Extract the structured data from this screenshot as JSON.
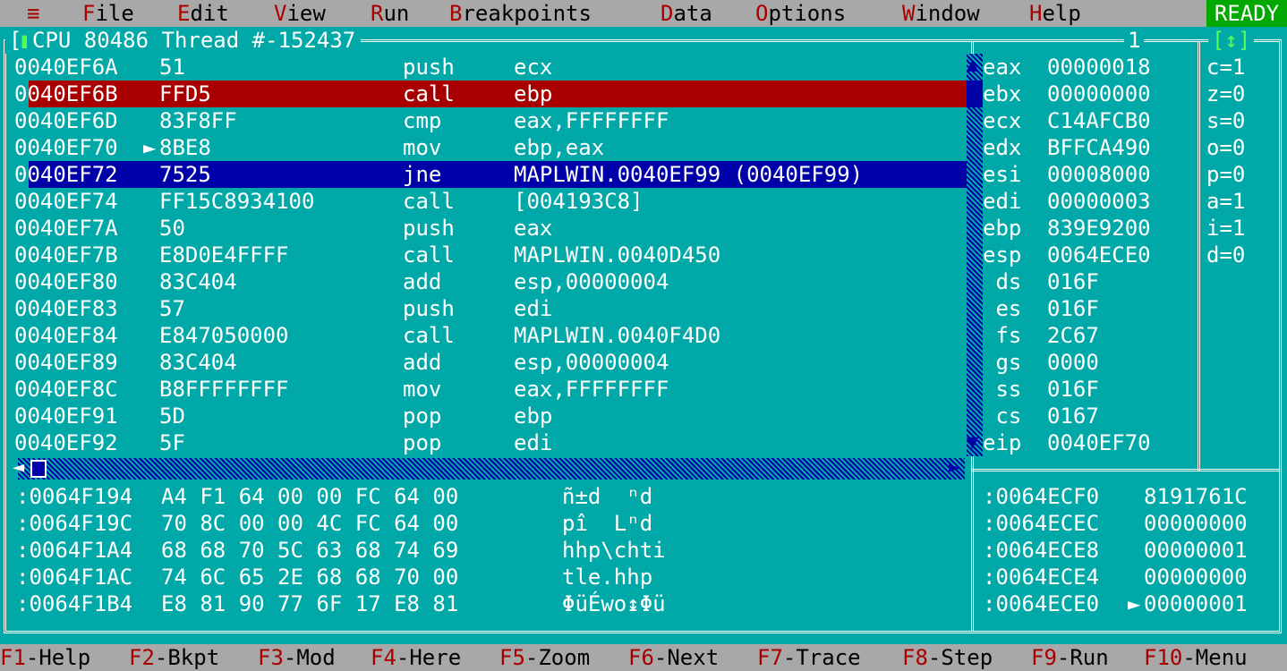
{
  "menubar": {
    "system": "≡",
    "items": [
      {
        "hot": "F",
        "rest": "ile"
      },
      {
        "hot": "E",
        "rest": "dit"
      },
      {
        "hot": "V",
        "rest": "iew"
      },
      {
        "hot": "R",
        "rest": "un"
      },
      {
        "hot": "B",
        "rest": "reakpoints"
      },
      {
        "hot": "D",
        "rest": "ata"
      },
      {
        "hot": "O",
        "rest": "ptions"
      },
      {
        "hot": "W",
        "rest": "indow"
      },
      {
        "hot": "H",
        "rest": "elp"
      }
    ],
    "status": "READY"
  },
  "window": {
    "close_open": "[",
    "close_box": "■",
    "close_close": "]",
    "title": "CPU 80486 Thread #-152437",
    "number": "1",
    "zoom": "[↕]"
  },
  "disasm": {
    "rows": [
      {
        "addr": "0040EF6A",
        "mark": " ",
        "bytes": "51",
        "mnem": "push",
        "ops": "ecx",
        "hl": ""
      },
      {
        "addr": "0040EF6B",
        "mark": " ",
        "bytes": "FFD5",
        "mnem": "call",
        "ops": "ebp",
        "hl": "red"
      },
      {
        "addr": "0040EF6D",
        "mark": " ",
        "bytes": "83F8FF",
        "mnem": "cmp",
        "ops": "eax,FFFFFFFF",
        "hl": ""
      },
      {
        "addr": "0040EF70",
        "mark": "►",
        "bytes": "8BE8",
        "mnem": "mov",
        "ops": "ebp,eax",
        "hl": ""
      },
      {
        "addr": "0040EF72",
        "mark": " ",
        "bytes": "7525",
        "mnem": "jne",
        "ops": "MAPLWIN.0040EF99 (0040EF99)",
        "hl": "blue"
      },
      {
        "addr": "0040EF74",
        "mark": " ",
        "bytes": "FF15C8934100",
        "mnem": "call",
        "ops": "[004193C8]",
        "hl": ""
      },
      {
        "addr": "0040EF7A",
        "mark": " ",
        "bytes": "50",
        "mnem": "push",
        "ops": "eax",
        "hl": ""
      },
      {
        "addr": "0040EF7B",
        "mark": " ",
        "bytes": "E8D0E4FFFF",
        "mnem": "call",
        "ops": "MAPLWIN.0040D450",
        "hl": ""
      },
      {
        "addr": "0040EF80",
        "mark": " ",
        "bytes": "83C404",
        "mnem": "add",
        "ops": "esp,00000004",
        "hl": ""
      },
      {
        "addr": "0040EF83",
        "mark": " ",
        "bytes": "57",
        "mnem": "push",
        "ops": "edi",
        "hl": ""
      },
      {
        "addr": "0040EF84",
        "mark": " ",
        "bytes": "E847050000",
        "mnem": "call",
        "ops": "MAPLWIN.0040F4D0",
        "hl": ""
      },
      {
        "addr": "0040EF89",
        "mark": " ",
        "bytes": "83C404",
        "mnem": "add",
        "ops": "esp,00000004",
        "hl": ""
      },
      {
        "addr": "0040EF8C",
        "mark": " ",
        "bytes": "B8FFFFFFFF",
        "mnem": "mov",
        "ops": "eax,FFFFFFFF",
        "hl": ""
      },
      {
        "addr": "0040EF91",
        "mark": " ",
        "bytes": "5D",
        "mnem": "pop",
        "ops": "ebp",
        "hl": ""
      },
      {
        "addr": "0040EF92",
        "mark": " ",
        "bytes": "5F",
        "mnem": "pop",
        "ops": "edi",
        "hl": ""
      }
    ]
  },
  "registers": [
    {
      "name": "eax",
      "value": "00000018"
    },
    {
      "name": "ebx",
      "value": "00000000"
    },
    {
      "name": "ecx",
      "value": "C14AFCB0"
    },
    {
      "name": "edx",
      "value": "BFFCA490"
    },
    {
      "name": "esi",
      "value": "00008000"
    },
    {
      "name": "edi",
      "value": "00000003"
    },
    {
      "name": "ebp",
      "value": "839E9200"
    },
    {
      "name": "esp",
      "value": "0064ECE0"
    },
    {
      "name": " ds",
      "value": "016F"
    },
    {
      "name": " es",
      "value": "016F"
    },
    {
      "name": " fs",
      "value": "2C67"
    },
    {
      "name": " gs",
      "value": "0000"
    },
    {
      "name": " ss",
      "value": "016F"
    },
    {
      "name": " cs",
      "value": "0167"
    },
    {
      "name": "eip",
      "value": "0040EF70"
    }
  ],
  "flags": [
    "c=1",
    "z=0",
    "s=0",
    "o=0",
    "p=0",
    "a=1",
    "i=1",
    "d=0"
  ],
  "dump": {
    "rows": [
      {
        "addr": ":0064F194",
        "bytes": "A4 F1 64 00 00 FC 64 00",
        "ascii": "ñ±d  ⁿd"
      },
      {
        "addr": ":0064F19C",
        "bytes": "70 8C 00 00 4C FC 64 00",
        "ascii": "pî  Lⁿd"
      },
      {
        "addr": ":0064F1A4",
        "bytes": "68 68 70 5C 63 68 74 69",
        "ascii": "hhp\\chti"
      },
      {
        "addr": ":0064F1AC",
        "bytes": "74 6C 65 2E 68 68 70 00",
        "ascii": "tle.hhp"
      },
      {
        "addr": ":0064F1B4",
        "bytes": "E8 81 90 77 6F 17 E8 81",
        "ascii": "ΦüÉwo↨Φü"
      }
    ]
  },
  "stack": {
    "rows": [
      {
        "addr": ":0064ECF0",
        "mark": " ",
        "value": "8191761C"
      },
      {
        "addr": ":0064ECEC",
        "mark": " ",
        "value": "00000000"
      },
      {
        "addr": ":0064ECE8",
        "mark": " ",
        "value": "00000001"
      },
      {
        "addr": ":0064ECE4",
        "mark": " ",
        "value": "00000000"
      },
      {
        "addr": ":0064ECE0",
        "mark": "►",
        "value": "00000001"
      }
    ]
  },
  "statusbar": [
    {
      "key": "F1",
      "label": "-Help"
    },
    {
      "key": "F2",
      "label": "-Bkpt"
    },
    {
      "key": "F3",
      "label": "-Mod"
    },
    {
      "key": "F4",
      "label": "-Here"
    },
    {
      "key": "F5",
      "label": "-Zoom"
    },
    {
      "key": "F6",
      "label": "-Next"
    },
    {
      "key": "F7",
      "label": "-Trace"
    },
    {
      "key": "F8",
      "label": "-Step"
    },
    {
      "key": "F9",
      "label": "-Run"
    },
    {
      "key": "F10",
      "label": "-Menu"
    }
  ],
  "colors": {
    "background": "#00a8a8",
    "menubar": "#a8a8a8",
    "hotkey": "#a80000",
    "execution_line": "#a80000",
    "cursor_line": "#0000a8",
    "ready": "#00a800"
  }
}
